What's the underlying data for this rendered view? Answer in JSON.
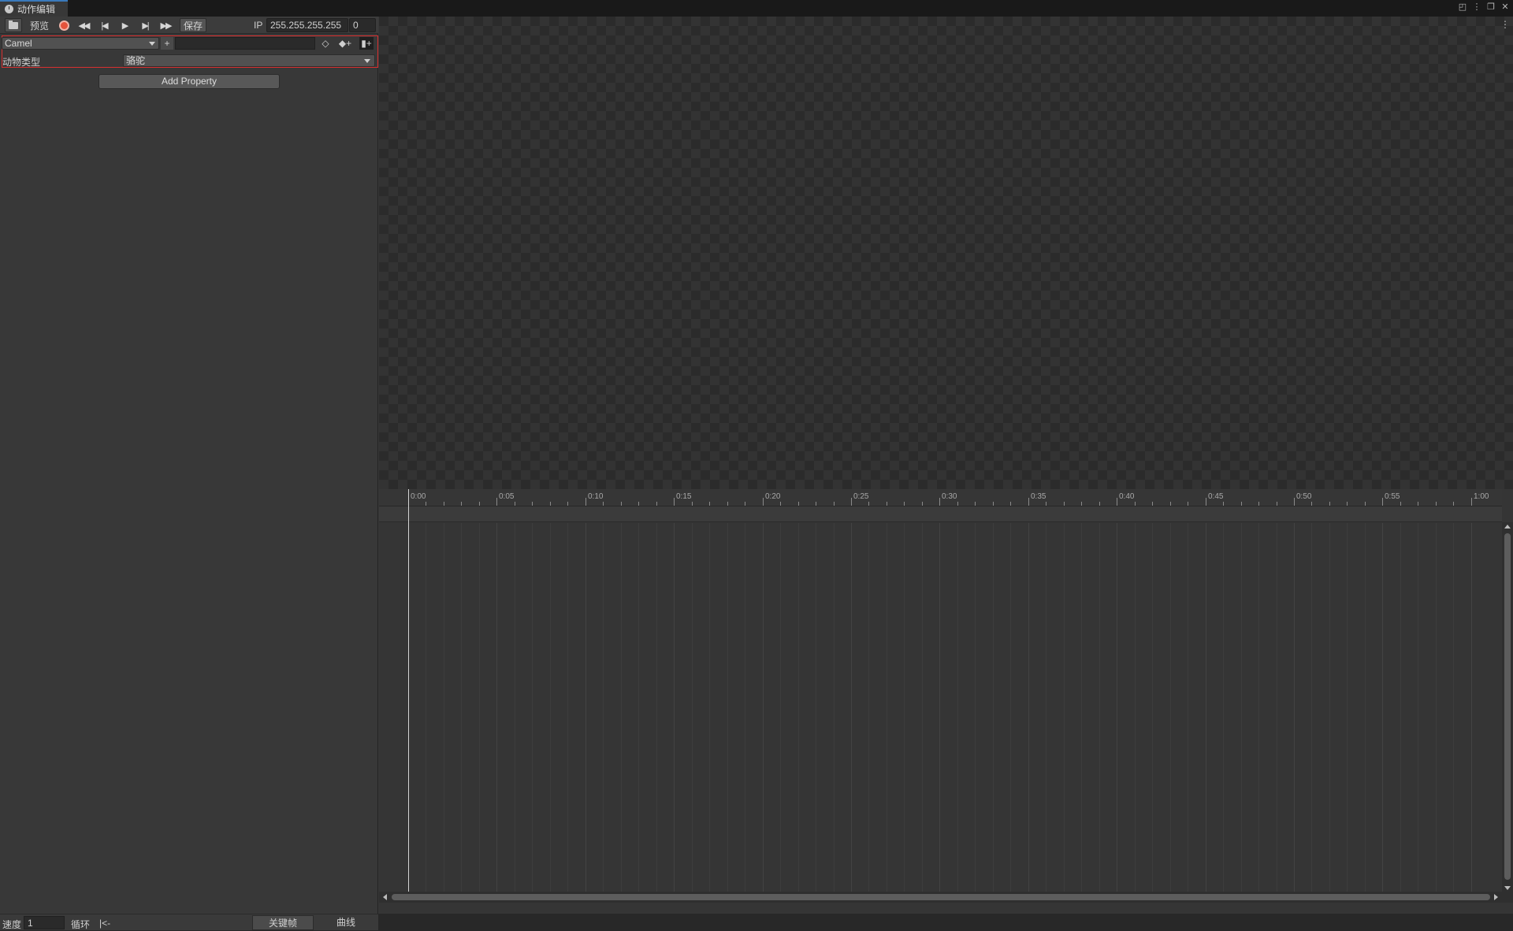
{
  "window": {
    "tab_title": "动作编辑",
    "controls": [
      "lock-icon",
      "kebab-menu-icon",
      "maximize-icon",
      "close-icon"
    ]
  },
  "toolbar": {
    "preview_label": "预览",
    "save_label": "保存",
    "ip_label": "IP",
    "ip_value": "255.255.255.255",
    "port_value": "0"
  },
  "object_row": {
    "selected_object": "Camel",
    "add_label": "+",
    "name_value": ""
  },
  "property_row": {
    "label": "动物类型",
    "selected_value": "骆驼"
  },
  "add_property_label": "Add Property",
  "timeline": {
    "tick_labels": [
      "0:00",
      "0:05",
      "0:10",
      "0:15",
      "0:20",
      "0:25",
      "0:30",
      "0:35",
      "0:40",
      "0:45",
      "0:50",
      "0:55",
      "1:00"
    ]
  },
  "bottom_bar": {
    "speed_label": "速度",
    "speed_value": "1",
    "loop_label": "循环",
    "back_label": "|<-",
    "keyframe_tab": "关键帧",
    "curve_tab": "曲线"
  },
  "colors": {
    "highlight_border": "#d93030",
    "record_button": "#e5533b",
    "tab_accent": "#3a79bb"
  }
}
